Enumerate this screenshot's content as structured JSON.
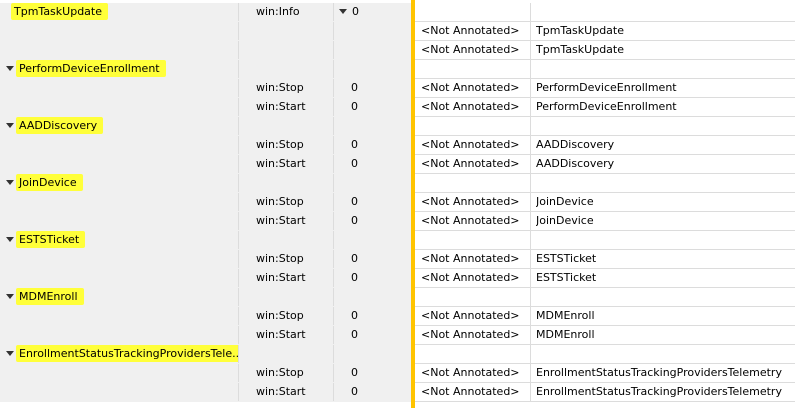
{
  "rows": [
    {
      "kind": "group",
      "name": "TpmTaskUpdate",
      "expanded": false,
      "level": "win:Info",
      "count": "0",
      "count_expander": true
    },
    {
      "kind": "detail",
      "annotation": "<Not Annotated>",
      "event": "TpmTaskUpdate"
    },
    {
      "kind": "detail",
      "annotation": "<Not Annotated>",
      "event": "TpmTaskUpdate"
    },
    {
      "kind": "group",
      "name": "PerformDeviceEnrollment",
      "expanded": true
    },
    {
      "kind": "detail",
      "opcode": "win:Stop",
      "count": "0",
      "annotation": "<Not Annotated>",
      "event": "PerformDeviceEnrollment"
    },
    {
      "kind": "detail",
      "opcode": "win:Start",
      "count": "0",
      "annotation": "<Not Annotated>",
      "event": "PerformDeviceEnrollment"
    },
    {
      "kind": "group",
      "name": "AADDiscovery",
      "expanded": true
    },
    {
      "kind": "detail",
      "opcode": "win:Stop",
      "count": "0",
      "annotation": "<Not Annotated>",
      "event": "AADDiscovery"
    },
    {
      "kind": "detail",
      "opcode": "win:Start",
      "count": "0",
      "annotation": "<Not Annotated>",
      "event": "AADDiscovery"
    },
    {
      "kind": "group",
      "name": "JoinDevice",
      "expanded": true
    },
    {
      "kind": "detail",
      "opcode": "win:Stop",
      "count": "0",
      "annotation": "<Not Annotated>",
      "event": "JoinDevice"
    },
    {
      "kind": "detail",
      "opcode": "win:Start",
      "count": "0",
      "annotation": "<Not Annotated>",
      "event": "JoinDevice"
    },
    {
      "kind": "group",
      "name": "ESTSTicket",
      "expanded": true
    },
    {
      "kind": "detail",
      "opcode": "win:Stop",
      "count": "0",
      "annotation": "<Not Annotated>",
      "event": "ESTSTicket"
    },
    {
      "kind": "detail",
      "opcode": "win:Start",
      "count": "0",
      "annotation": "<Not Annotated>",
      "event": "ESTSTicket"
    },
    {
      "kind": "group",
      "name": "MDMEnroll",
      "expanded": true
    },
    {
      "kind": "detail",
      "opcode": "win:Stop",
      "count": "0",
      "annotation": "<Not Annotated>",
      "event": "MDMEnroll"
    },
    {
      "kind": "detail",
      "opcode": "win:Start",
      "count": "0",
      "annotation": "<Not Annotated>",
      "event": "MDMEnroll"
    },
    {
      "kind": "group",
      "name": "EnrollmentStatusTrackingProvidersTele...",
      "expanded": true
    },
    {
      "kind": "detail",
      "opcode": "win:Stop",
      "count": "0",
      "annotation": "<Not Annotated>",
      "event": "EnrollmentStatusTrackingProvidersTelemetry"
    },
    {
      "kind": "detail",
      "opcode": "win:Start",
      "count": "0",
      "annotation": "<Not Annotated>",
      "event": "EnrollmentStatusTrackingProvidersTelemetry"
    }
  ],
  "colors": {
    "highlight": "#ffff3a",
    "separator": "#ffc400",
    "left_bg": "#f0f0f0",
    "grid_line": "#dcdcdc"
  },
  "icons": {
    "expand": "expand-triangle-icon"
  }
}
